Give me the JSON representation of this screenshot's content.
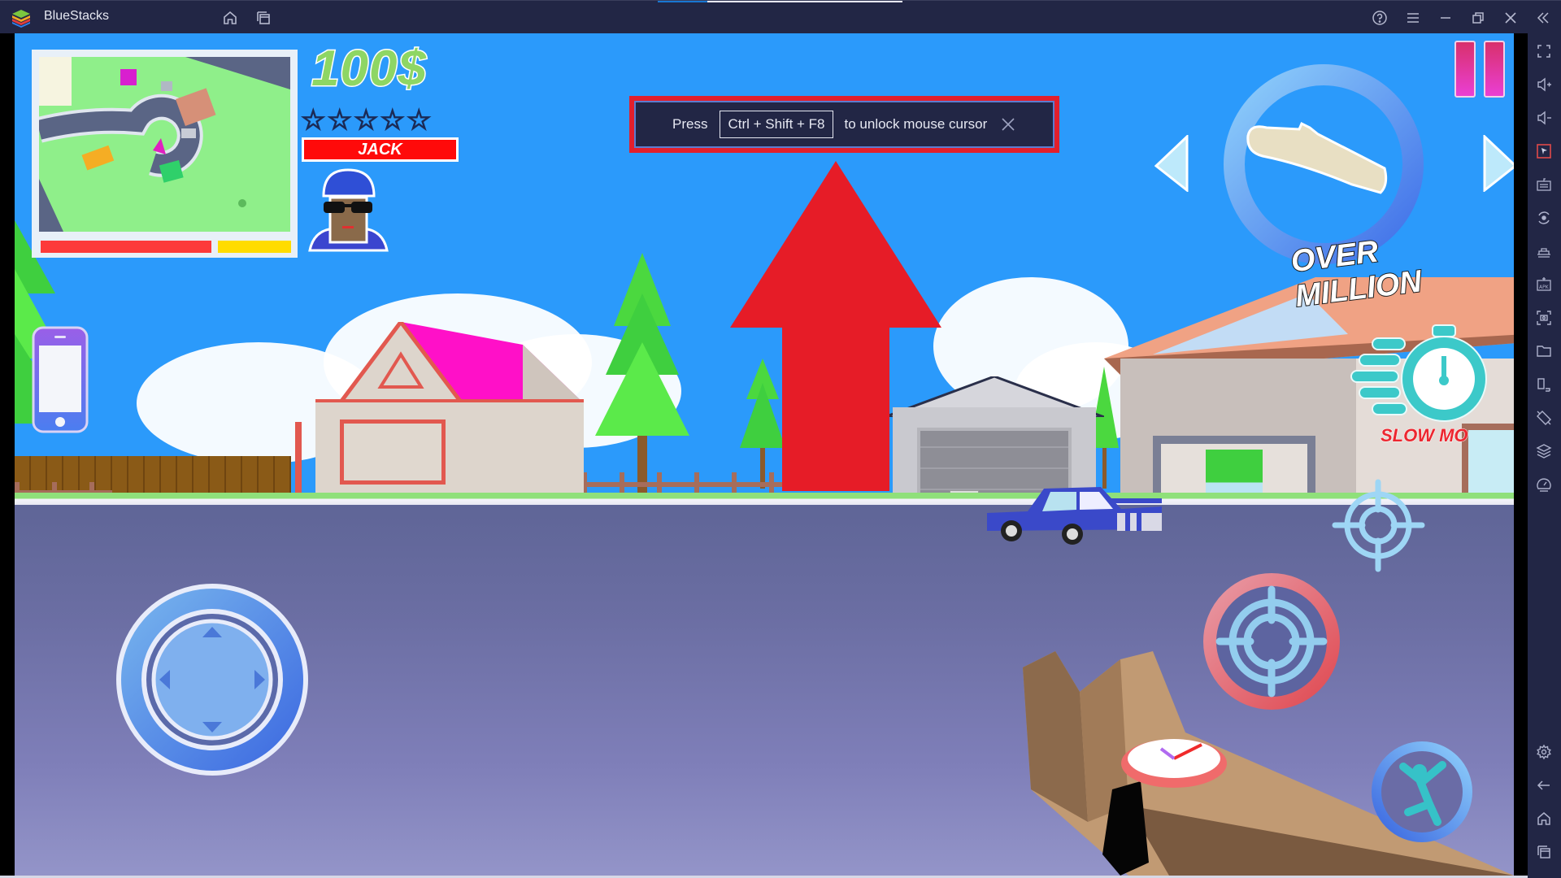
{
  "window": {
    "app_title": "BlueStacks",
    "titlebar_icons": [
      "home-icon",
      "multi-instance-icon"
    ],
    "window_controls": [
      "help-icon",
      "menu-icon",
      "minimize-icon",
      "restore-icon",
      "close-icon",
      "collapse-sidebar-icon"
    ]
  },
  "toast": {
    "prefix": "Press",
    "shortcut": "Ctrl + Shift + F8",
    "suffix": "to unlock mouse cursor",
    "close_icon": "close-icon"
  },
  "hud": {
    "money": "100$",
    "wanted_stars_filled": 0,
    "wanted_stars_total": 5,
    "character_name": "JACK",
    "health_fraction": 0.7,
    "armor_fraction": 0.3,
    "weapon_label": "OVER MILLION",
    "slowmo_label": "SLOW MO",
    "colors": {
      "money": "#8ed664",
      "name_badge": "#ff0a0a",
      "health": "#fd3a3a",
      "armor": "#ffdc00",
      "pause": "#e0308f",
      "slowmo": "#3cc9c9",
      "annotation_arrow": "#e61c27"
    }
  },
  "sidebar": {
    "items": [
      {
        "name": "fullscreen-icon",
        "label": "Full screen"
      },
      {
        "name": "volume-up-icon",
        "label": "Volume up"
      },
      {
        "name": "volume-down-icon",
        "label": "Volume down"
      },
      {
        "name": "pointer-lock-icon",
        "label": "Lock cursor",
        "active": true
      },
      {
        "name": "keyboard-controls-icon",
        "label": "Game controls"
      },
      {
        "name": "sync-icon",
        "label": "Macro"
      },
      {
        "name": "multi-instance-sync-icon",
        "label": "Sync"
      },
      {
        "name": "install-apk-icon",
        "label": "Install APK"
      },
      {
        "name": "screenshot-icon",
        "label": "Screenshot"
      },
      {
        "name": "folder-icon",
        "label": "Media folder"
      },
      {
        "name": "resize-icon",
        "label": "Resize"
      },
      {
        "name": "rotate-icon",
        "label": "Rotate"
      },
      {
        "name": "layers-icon",
        "label": "Multi-instance"
      },
      {
        "name": "eco-mode-icon",
        "label": "Eco mode"
      },
      {
        "name": "settings-icon",
        "label": "Settings"
      },
      {
        "name": "back-icon",
        "label": "Back"
      },
      {
        "name": "home-icon",
        "label": "Home"
      },
      {
        "name": "recent-apps-icon",
        "label": "Recent apps"
      }
    ]
  }
}
